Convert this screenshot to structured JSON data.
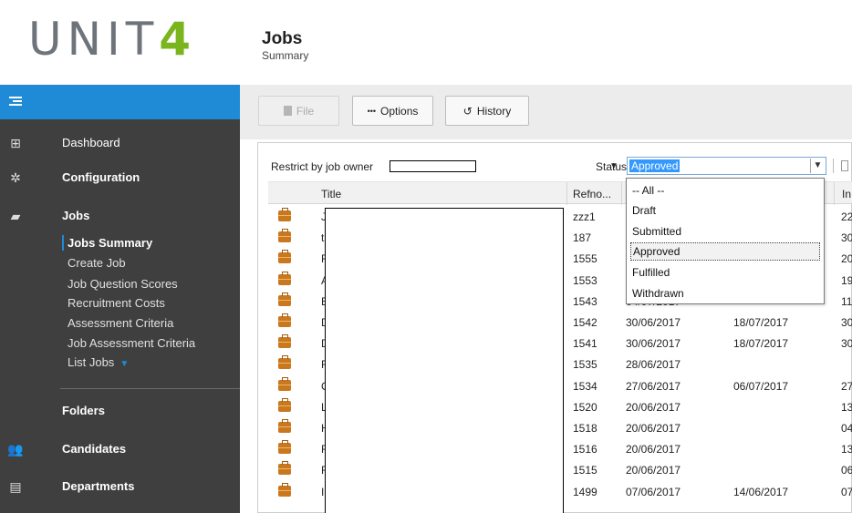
{
  "brand": {
    "logo_text": "UNIT",
    "logo_accent": "4",
    "accent_color": "#7ab51d",
    "primary_color": "#1f8ad6"
  },
  "header": {
    "title": "Jobs",
    "subtitle": "Summary"
  },
  "sidebar": {
    "items": [
      {
        "label": "Dashboard",
        "icon": "grid-icon"
      },
      {
        "label": "Configuration",
        "icon": "gear-icon"
      },
      {
        "label": "Jobs",
        "icon": "briefcase-icon"
      },
      {
        "label": "Folders",
        "icon": ""
      },
      {
        "label": "Candidates",
        "icon": "people-icon"
      },
      {
        "label": "Departments",
        "icon": "building-icon"
      }
    ],
    "jobs_sub": [
      {
        "label": "Jobs Summary",
        "active": true
      },
      {
        "label": "Create Job"
      },
      {
        "label": "Job Question Scores"
      },
      {
        "label": "Recruitment Costs"
      },
      {
        "label": "Assessment Criteria"
      },
      {
        "label": "Job Assessment Criteria"
      },
      {
        "label": "List Jobs"
      }
    ]
  },
  "toolbar": {
    "file_label": "File",
    "options_label": "Options",
    "history_label": "History"
  },
  "filters": {
    "owner_label": "Restrict by job owner",
    "status_label": "Status",
    "status_value": "Approved"
  },
  "status_options": [
    "-- All --",
    "Draft",
    "Submitted",
    "Approved",
    "Fulfilled",
    "Withdrawn"
  ],
  "table": {
    "columns": [
      "Title",
      "Refno...",
      "In"
    ],
    "rows": [
      {
        "title": "J",
        "refno": "zzz1",
        "date1": "",
        "date2": "",
        "last": "22"
      },
      {
        "title": "t",
        "refno": "187",
        "date1": "",
        "date2": "",
        "last": "30"
      },
      {
        "title": "F",
        "refno": "1555",
        "date1": "",
        "date2": "",
        "last": "20"
      },
      {
        "title": "A",
        "refno": "1553",
        "date1": "",
        "date2": "",
        "last": "19"
      },
      {
        "title": "E",
        "refno": "1543",
        "date1": "04/07/2017",
        "date2": "",
        "last": "11"
      },
      {
        "title": "D",
        "refno": "1542",
        "date1": "30/06/2017",
        "date2": "18/07/2017",
        "last": "30"
      },
      {
        "title": "D",
        "refno": "1541",
        "date1": "30/06/2017",
        "date2": "18/07/2017",
        "last": "30"
      },
      {
        "title": "F",
        "refno": "1535",
        "date1": "28/06/2017",
        "date2": "",
        "last": ""
      },
      {
        "title": "C",
        "refno": "1534",
        "date1": "27/06/2017",
        "date2": "06/07/2017",
        "last": "27"
      },
      {
        "title": "L",
        "refno": "1520",
        "date1": "20/06/2017",
        "date2": "",
        "last": "13"
      },
      {
        "title": "H",
        "refno": "1518",
        "date1": "20/06/2017",
        "date2": "",
        "last": "04"
      },
      {
        "title": "F",
        "refno": "1516",
        "date1": "20/06/2017",
        "date2": "",
        "last": "13"
      },
      {
        "title": "F",
        "refno": "1515",
        "date1": "20/06/2017",
        "date2": "",
        "last": "06"
      },
      {
        "title": "I",
        "refno": "1499",
        "date1": "07/06/2017",
        "date2": "14/06/2017",
        "last": "07"
      }
    ]
  }
}
